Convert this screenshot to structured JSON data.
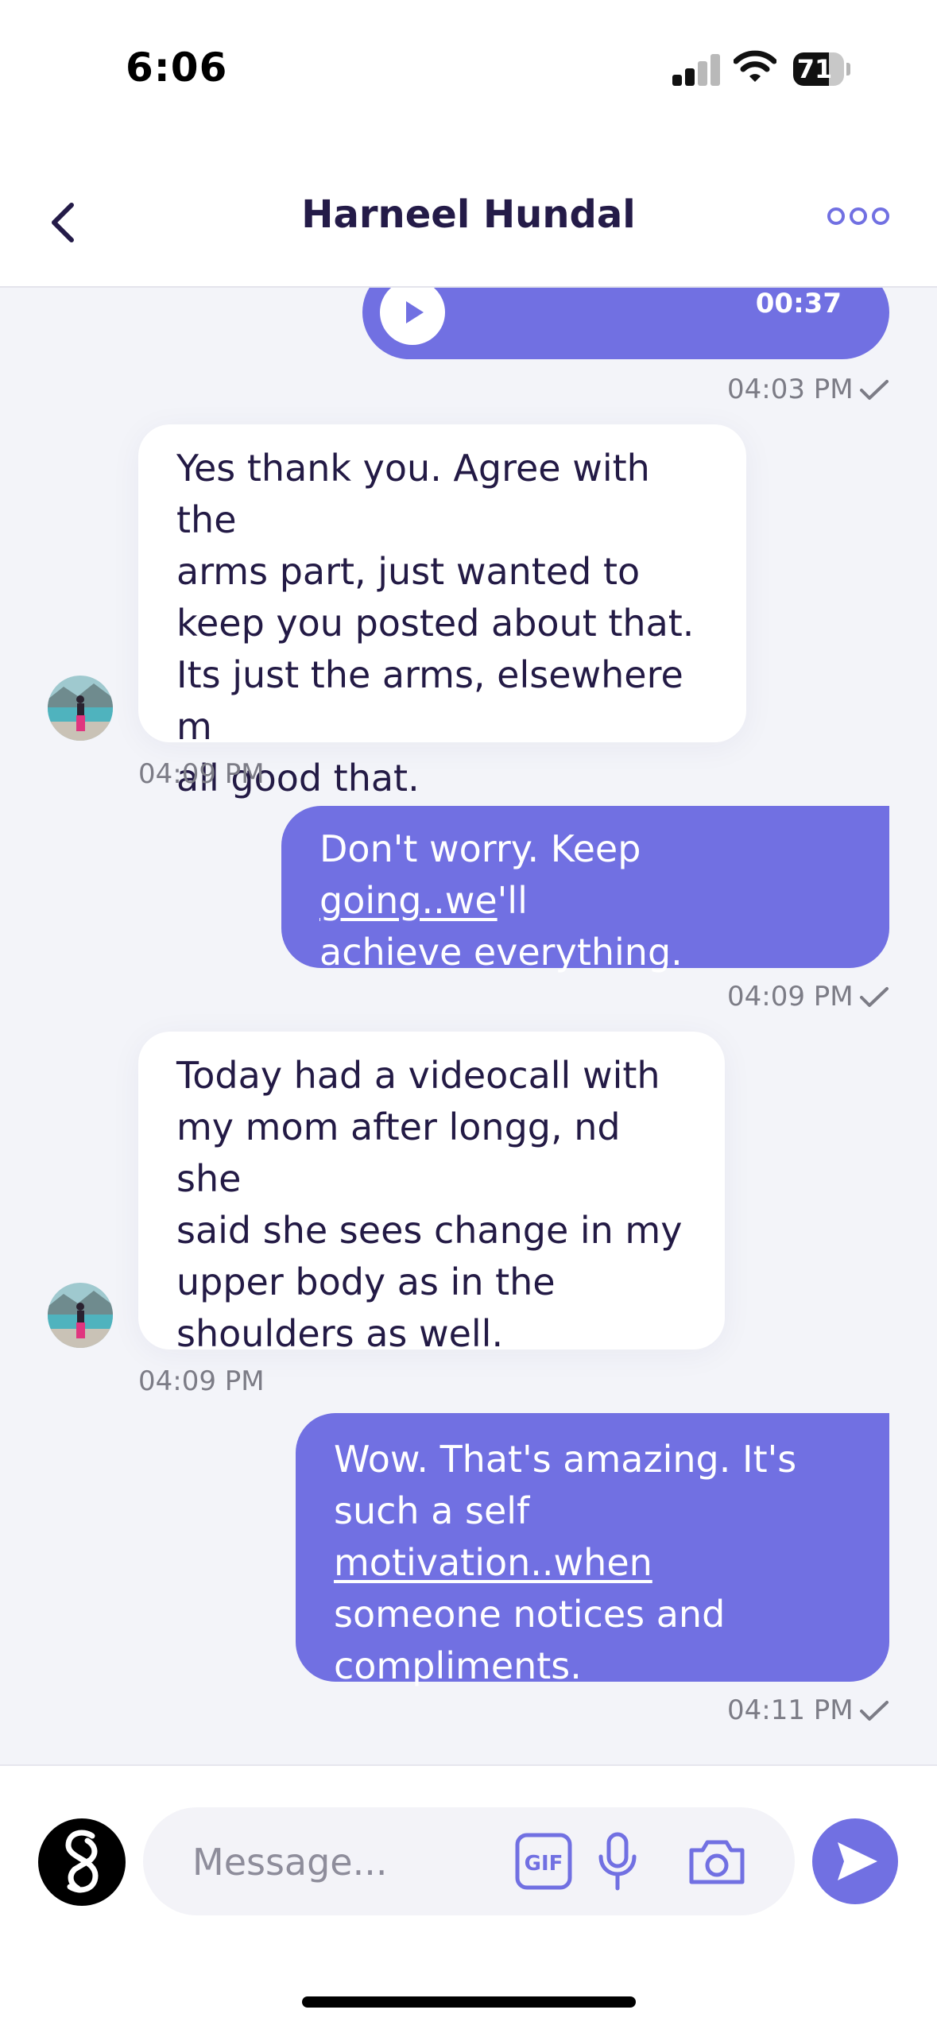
{
  "status_bar": {
    "time": "6:06",
    "battery": "71",
    "battery_level": 0.71
  },
  "header": {
    "title": "Harneel Hundal",
    "back_icon": "chevron-left-icon",
    "more_icon": "more-dots-icon"
  },
  "audio_message": {
    "duration": "00:37"
  },
  "messages": [
    {
      "type": "sent-audio",
      "time": "04:03 PM"
    },
    {
      "type": "received",
      "time": "04:09 PM",
      "lines": [
        "Yes thank you. Agree with the",
        "arms part, just wanted to",
        "keep you posted about that.",
        "Its just the arms, elsewhere m",
        "all good that."
      ]
    },
    {
      "type": "sent",
      "time": "04:09 PM",
      "line1_a": "Don't worry. Keep ",
      "line1_link": "going..we",
      "line1_b": "'ll",
      "line2": "achieve everything."
    },
    {
      "type": "received",
      "time": "04:09 PM",
      "lines": [
        "Today had a videocall with",
        "my mom after longg, nd she",
        "said she sees change in my",
        "upper body as in the",
        "shoulders as well."
      ]
    },
    {
      "type": "sent",
      "time": "04:11 PM",
      "line1": "Wow. That's amazing. It's",
      "line2_a": "such a self ",
      "line2_link": "motivation..when",
      "line3": "someone notices and",
      "line4": "compliments."
    }
  ],
  "composer": {
    "placeholder": "Message...",
    "gif_label": "GIF"
  },
  "colors": {
    "accent": "#7170e2",
    "title": "#241b48",
    "background": "#f3f4f9"
  }
}
